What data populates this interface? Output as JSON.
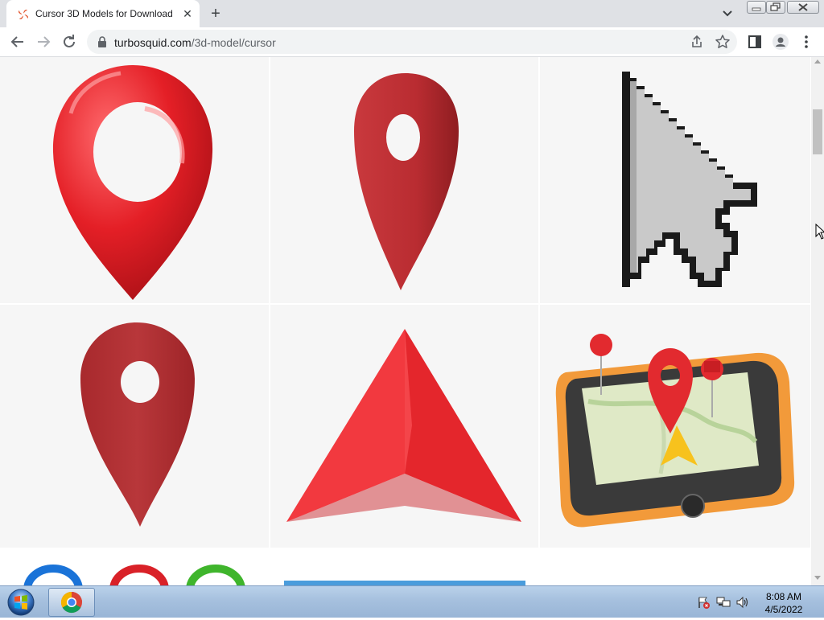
{
  "browser": {
    "tab": {
      "title": "Cursor 3D Models for Download"
    },
    "address_bar": {
      "domain": "turbosquid.com",
      "path": "/3d-model/cursor"
    }
  },
  "icons": {
    "tab_favicon": "turbosquid-favicon",
    "tab_close": "close-icon",
    "new_tab": "plus-icon",
    "tab_search": "chevron-down-icon",
    "back": "back-arrow-icon",
    "forward": "forward-arrow-icon",
    "reload": "reload-icon",
    "lock": "lock-icon",
    "share": "share-icon",
    "bookmark": "star-icon",
    "side_panel": "side-panel-icon",
    "profile": "profile-icon",
    "menu": "kebab-menu-icon"
  },
  "glyphs": {
    "close": "✕",
    "plus": "+"
  },
  "gallery": {
    "items": [
      "red-location-pin-glossy",
      "red-location-pin-matte",
      "pixel-arrow-cursor",
      "dark-red-location-pin",
      "red-navigation-arrow",
      "smartphone-map-with-pins",
      "colored-rings",
      "blue-banner-item",
      "white-item"
    ]
  },
  "taskbar": {
    "clock": {
      "time": "8:08 AM",
      "date": "4/5/2022"
    }
  },
  "colors": {
    "tabstrip": "#dfe1e5",
    "pin_red": "#e8242b",
    "pin_dark_red": "#b53a3c",
    "cell_bg": "#f6f6f6",
    "taskbar": "#a6c0de"
  }
}
